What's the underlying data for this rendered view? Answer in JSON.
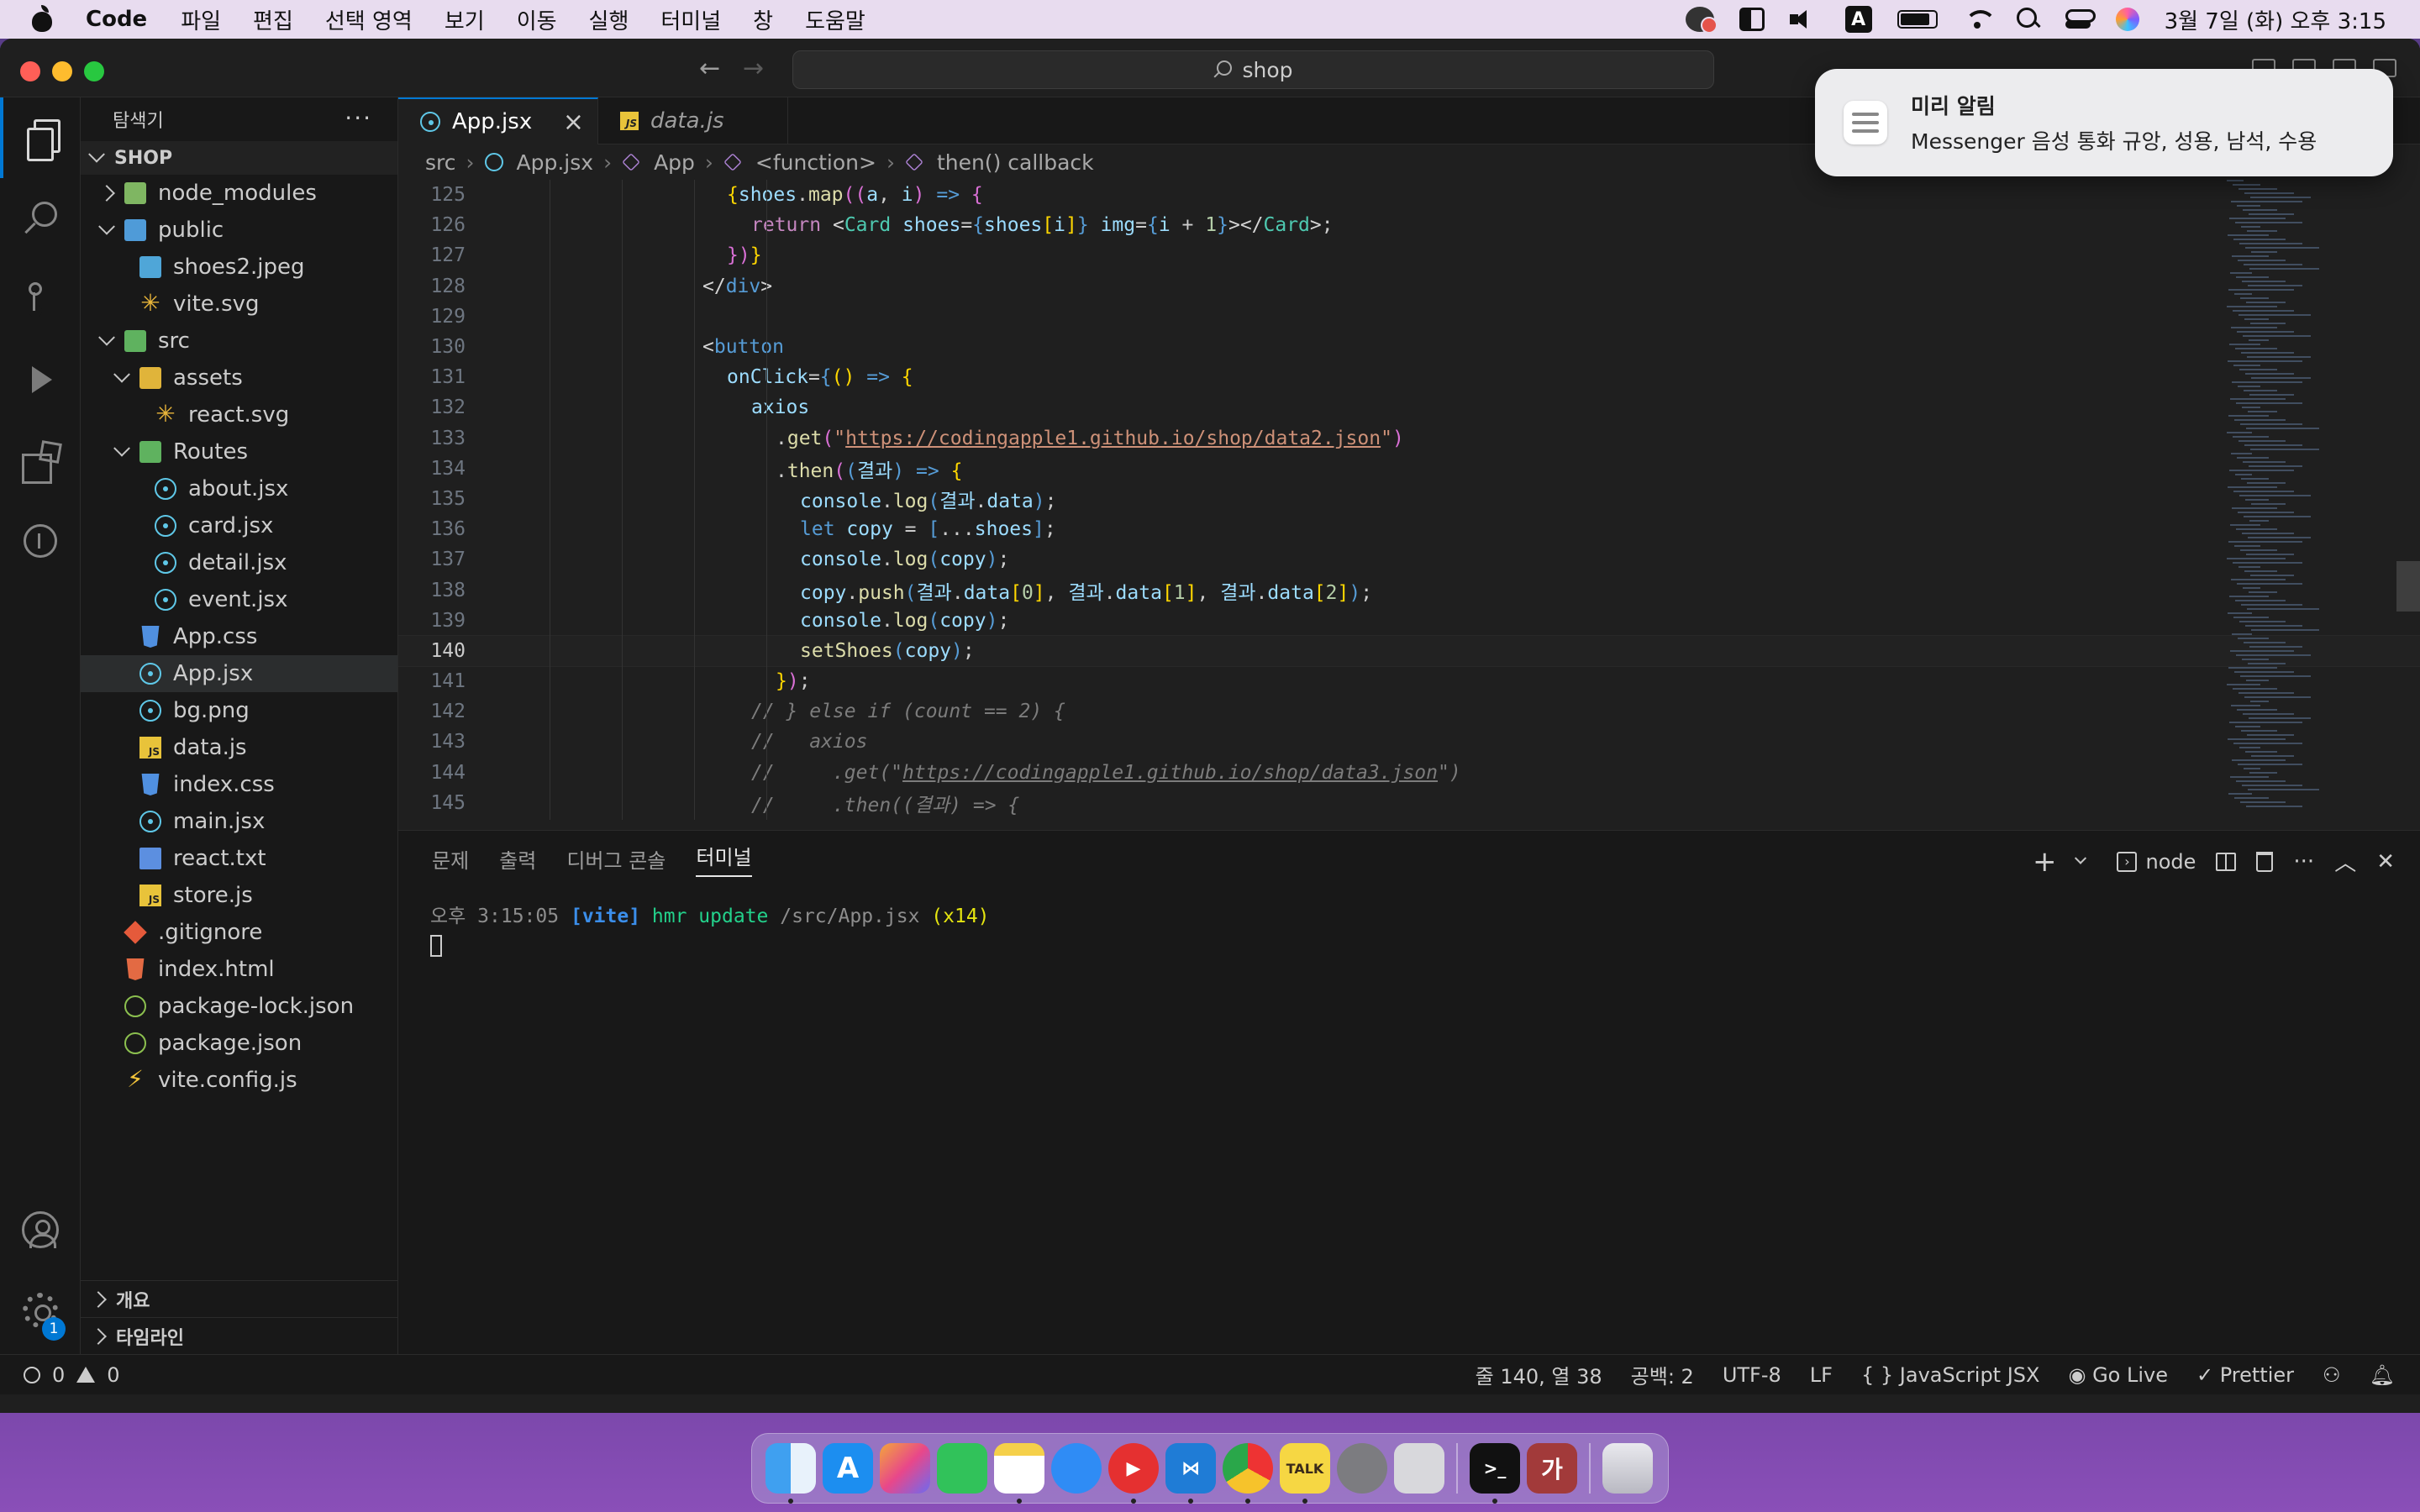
{
  "menubar": {
    "app_name": "Code",
    "items": [
      "파일",
      "편집",
      "선택 영역",
      "보기",
      "이동",
      "실행",
      "터미널",
      "창",
      "도움말"
    ],
    "input_source": "A",
    "clock": "3월 7일 (화) 오후 3:15"
  },
  "titlebar": {
    "search_text": "shop"
  },
  "sidebar": {
    "title": "탐색기",
    "more": "···",
    "section": "SHOP",
    "tree": [
      {
        "label": "node_modules",
        "depth": 0,
        "kind": "folder-closed",
        "icon": "folder"
      },
      {
        "label": "public",
        "depth": 0,
        "kind": "folder-open",
        "icon": "folder-blue"
      },
      {
        "label": "shoes2.jpeg",
        "depth": 1,
        "kind": "file",
        "icon": "img"
      },
      {
        "label": "vite.svg",
        "depth": 1,
        "kind": "file",
        "icon": "star"
      },
      {
        "label": "src",
        "depth": 0,
        "kind": "folder-open",
        "icon": "folder-green"
      },
      {
        "label": "assets",
        "depth": 1,
        "kind": "folder-open",
        "icon": "folder-yellow"
      },
      {
        "label": "react.svg",
        "depth": 2,
        "kind": "file",
        "icon": "star"
      },
      {
        "label": "Routes",
        "depth": 1,
        "kind": "folder-open",
        "icon": "folder-green"
      },
      {
        "label": "about.jsx",
        "depth": 2,
        "kind": "file",
        "icon": "react"
      },
      {
        "label": "card.jsx",
        "depth": 2,
        "kind": "file",
        "icon": "react"
      },
      {
        "label": "detail.jsx",
        "depth": 2,
        "kind": "file",
        "icon": "react"
      },
      {
        "label": "event.jsx",
        "depth": 2,
        "kind": "file",
        "icon": "react"
      },
      {
        "label": "App.css",
        "depth": 1,
        "kind": "file",
        "icon": "css"
      },
      {
        "label": "App.jsx",
        "depth": 1,
        "kind": "file",
        "icon": "react",
        "selected": true
      },
      {
        "label": "bg.png",
        "depth": 1,
        "kind": "file",
        "icon": "react"
      },
      {
        "label": "data.js",
        "depth": 1,
        "kind": "file",
        "icon": "js"
      },
      {
        "label": "index.css",
        "depth": 1,
        "kind": "file",
        "icon": "css"
      },
      {
        "label": "main.jsx",
        "depth": 1,
        "kind": "file",
        "icon": "react"
      },
      {
        "label": "react.txt",
        "depth": 1,
        "kind": "file",
        "icon": "txt"
      },
      {
        "label": "store.js",
        "depth": 1,
        "kind": "file",
        "icon": "js"
      },
      {
        "label": ".gitignore",
        "depth": 0,
        "kind": "file",
        "icon": "git"
      },
      {
        "label": "index.html",
        "depth": 0,
        "kind": "file",
        "icon": "html"
      },
      {
        "label": "package-lock.json",
        "depth": 0,
        "kind": "file",
        "icon": "json"
      },
      {
        "label": "package.json",
        "depth": 0,
        "kind": "file",
        "icon": "json"
      },
      {
        "label": "vite.config.js",
        "depth": 0,
        "kind": "file",
        "icon": "bolt"
      }
    ],
    "outline_label": "개요",
    "timeline_label": "타임라인"
  },
  "activitybar": {
    "settings_badge": "1"
  },
  "tabs": [
    {
      "label": "App.jsx",
      "active": true
    },
    {
      "label": "data.js",
      "active": false
    }
  ],
  "breadcrumbs": [
    "src",
    "App.jsx",
    "App",
    "<function>",
    "then() callback"
  ],
  "code": {
    "current_line": 140,
    "lines": [
      {
        "n": "125",
        "html": "<span class='tk-b'>{</span><span class='tk-v'>shoes</span>.<span class='tk-f'>map</span><span class='tk-mag'>((</span><span class='tk-v'>a</span>, <span class='tk-v'>i</span><span class='tk-mag'>)</span> <span class='tk-k'>=></span> <span class='tk-mag'>{</span>",
        "indent": 18
      },
      {
        "n": "126",
        "html": "<span class='tk-pk'>return</span> <span class='tk-p'>&lt;</span><span class='tk-t'>Card</span> <span class='tk-attr'>shoes</span>=<span class='tk-k'>{</span><span class='tk-v'>shoes</span><span class='tk-b'>[</span><span class='tk-v'>i</span><span class='tk-b'>]</span><span class='tk-k'>}</span> <span class='tk-attr'>img</span>=<span class='tk-k'>{</span><span class='tk-v'>i</span> + <span class='tk-n'>1</span><span class='tk-k'>}</span><span class='tk-p'>&gt;&lt;/</span><span class='tk-t'>Card</span><span class='tk-p'>&gt;</span>;",
        "indent": 20
      },
      {
        "n": "127",
        "html": "<span class='tk-mag'>})</span><span class='tk-b'>}</span>",
        "indent": 18
      },
      {
        "n": "128",
        "html": "<span class='tk-p'>&lt;/</span><span class='tk-tag'>div</span><span class='tk-p'>&gt;</span>",
        "indent": 16
      },
      {
        "n": "129",
        "html": "",
        "indent": 0
      },
      {
        "n": "130",
        "html": "<span class='tk-p'>&lt;</span><span class='tk-tag'>button</span>",
        "indent": 16
      },
      {
        "n": "131",
        "html": "<span class='tk-attr'>onClick</span>=<span class='tk-k'>{</span><span class='tk-b'>()</span> <span class='tk-k'>=></span> <span class='tk-b'>{</span>",
        "indent": 18
      },
      {
        "n": "132",
        "html": "<span class='tk-v'>axios</span>",
        "indent": 20
      },
      {
        "n": "133",
        "html": ".<span class='tk-f'>get</span><span class='tk-mag'>(</span><span class='tk-s'>\"</span><span class='tk-url'>https://codingapple1.github.io/shop/data2.json</span><span class='tk-s'>\"</span><span class='tk-mag'>)</span>",
        "indent": 22
      },
      {
        "n": "134",
        "html": ".<span class='tk-f'>then</span><span class='tk-mag'>(</span><span class='tk-k'>(</span><span class='tk-v'>결과</span><span class='tk-k'>)</span> <span class='tk-k'>=></span> <span class='tk-b'>{</span>",
        "indent": 22
      },
      {
        "n": "135",
        "html": "<span class='tk-v'>console</span>.<span class='tk-f'>log</span><span class='tk-k'>(</span><span class='tk-v'>결과</span>.<span class='tk-v'>data</span><span class='tk-k'>)</span>;",
        "indent": 24
      },
      {
        "n": "136",
        "html": "<span class='tk-k'>let</span> <span class='tk-v'>copy</span> = <span class='tk-k'>[</span>...<span class='tk-v'>shoes</span><span class='tk-k'>]</span>;",
        "indent": 24
      },
      {
        "n": "137",
        "html": "<span class='tk-v'>console</span>.<span class='tk-f'>log</span><span class='tk-k'>(</span><span class='tk-v'>copy</span><span class='tk-k'>)</span>;",
        "indent": 24
      },
      {
        "n": "138",
        "html": "<span class='tk-v'>copy</span>.<span class='tk-f'>push</span><span class='tk-k'>(</span><span class='tk-v'>결과</span>.<span class='tk-v'>data</span><span class='tk-b'>[</span><span class='tk-n'>0</span><span class='tk-b'>]</span>, <span class='tk-v'>결과</span>.<span class='tk-v'>data</span><span class='tk-b'>[</span><span class='tk-n'>1</span><span class='tk-b'>]</span>, <span class='tk-v'>결과</span>.<span class='tk-v'>data</span><span class='tk-b'>[</span><span class='tk-n'>2</span><span class='tk-b'>]</span><span class='tk-k'>)</span>;",
        "indent": 24
      },
      {
        "n": "139",
        "html": "<span class='tk-v'>console</span>.<span class='tk-f'>log</span><span class='tk-k'>(</span><span class='tk-v'>copy</span><span class='tk-k'>)</span>;",
        "indent": 24
      },
      {
        "n": "140",
        "html": "<span class='tk-f'>setShoes</span><span class='tk-k'>(</span><span class='tk-v'>copy</span><span class='tk-k'>)</span>;",
        "indent": 24
      },
      {
        "n": "141",
        "html": "<span class='tk-b'>}</span><span class='tk-mag'>)</span>;",
        "indent": 22
      },
      {
        "n": "142",
        "html": "<span class='tk-cm'>// } else if (count == 2) {</span>",
        "indent": 20
      },
      {
        "n": "143",
        "html": "<span class='tk-cm'>//   axios</span>",
        "indent": 20
      },
      {
        "n": "144",
        "html": "<span class='tk-cm'>//     .get(\"<u>https://codingapple1.github.io/shop/data3.json</u>\")</span>",
        "indent": 20
      },
      {
        "n": "145",
        "html": "<span class='tk-cm'>//     .then((결과) =&gt; {</span>",
        "indent": 20
      }
    ]
  },
  "panel": {
    "tabs": [
      "문제",
      "출력",
      "디버그 콘솔",
      "터미널"
    ],
    "active_tab": "터미널",
    "terminal_label": "node",
    "terminal": {
      "time": "오후 3:15:05",
      "tag": "[vite]",
      "message": "hmr update",
      "path": "/src/App.jsx",
      "count": "(x14)"
    }
  },
  "statusbar": {
    "errors": "0",
    "warnings": "0",
    "position": "줄 140, 열 38",
    "spaces": "공백: 2",
    "encoding": "UTF-8",
    "eol": "LF",
    "language": "JavaScript JSX",
    "language_icon": "{ }",
    "golive": "Go Live",
    "prettier": "Prettier"
  },
  "notification": {
    "title": "미리 알림",
    "body": "Messenger 음성 통화 규앙, 성용, 남석, 수용"
  },
  "dock": {
    "apps": [
      "finder-icon",
      "app-store-icon",
      "launchpad-icon",
      "facetime-icon",
      "notes-icon",
      "safari-icon",
      "youtube-music-icon",
      "vscode-icon",
      "chrome-icon",
      "kakaotalk-icon",
      "system-settings-icon",
      "preview-icon",
      "terminal-icon",
      "hangul-icon",
      "trash-icon"
    ],
    "kakaotalk_label": "TALK",
    "hangul_label": "가",
    "terminal_label": ">_"
  }
}
